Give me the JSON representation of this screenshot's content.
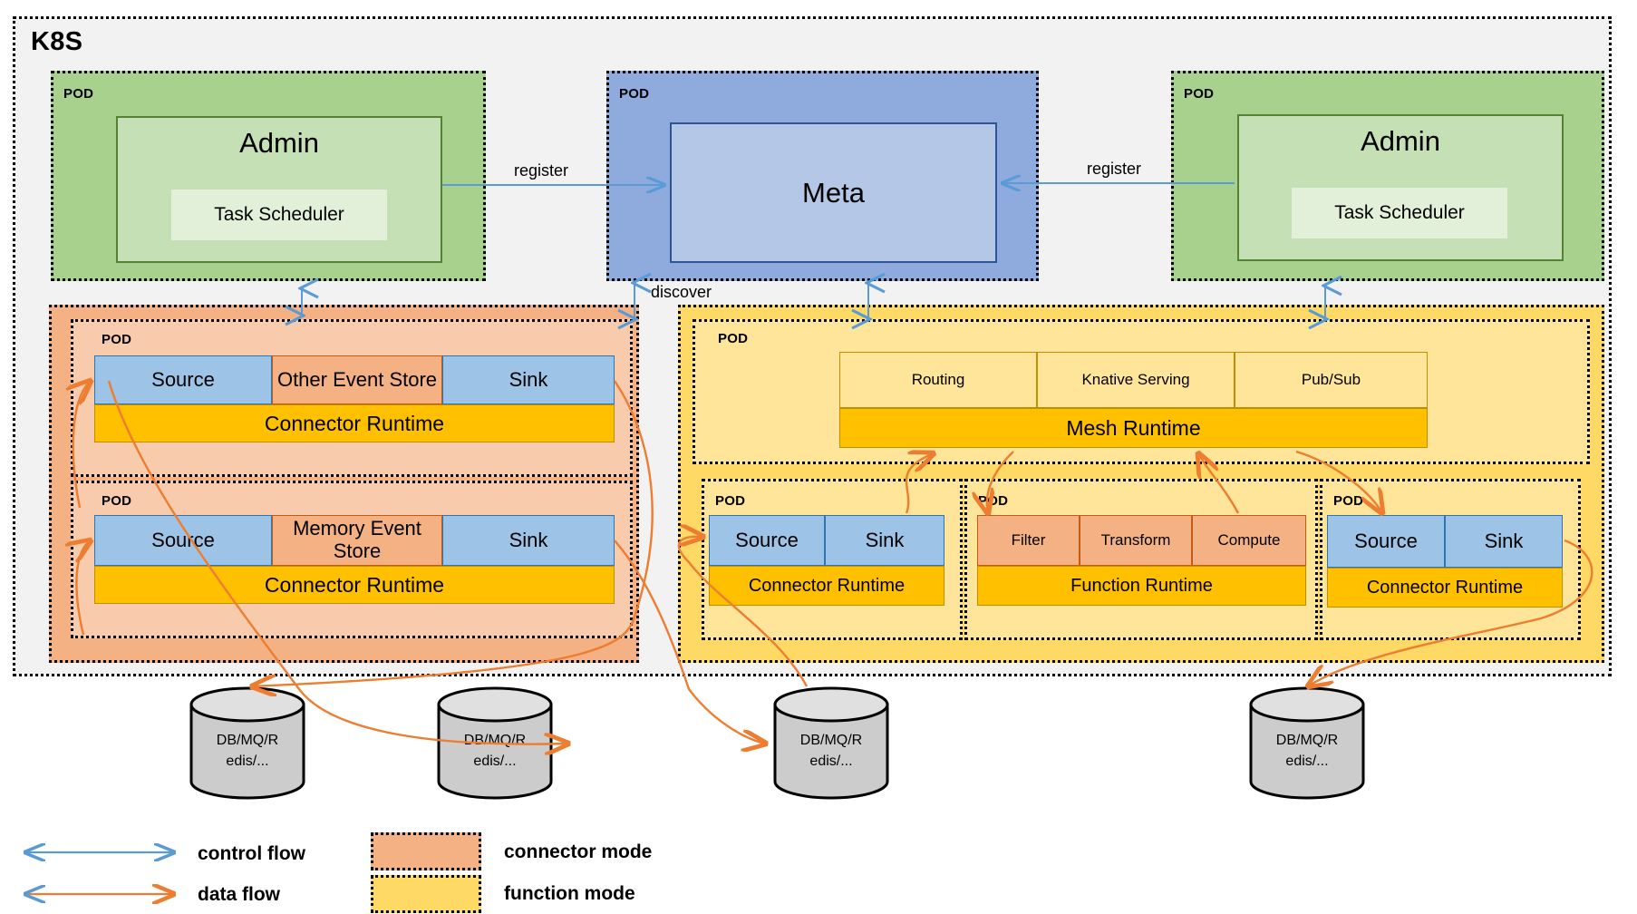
{
  "diagram": {
    "cluster_label": "K8S",
    "pod_label": "POD"
  },
  "admin_left": {
    "pod_label": "POD",
    "title": "Admin",
    "task_scheduler": "Task Scheduler"
  },
  "admin_right": {
    "pod_label": "POD",
    "title": "Admin",
    "task_scheduler": "Task Scheduler"
  },
  "meta": {
    "pod_label": "POD",
    "title": "Meta"
  },
  "edges": {
    "register_left": "register",
    "register_right": "register",
    "discover": "discover"
  },
  "connector_mode": {
    "pods": [
      {
        "pod_label": "POD",
        "cells": [
          "Source",
          "Other Event Store",
          "Sink"
        ],
        "runtime": "Connector Runtime"
      },
      {
        "pod_label": "POD",
        "cells": [
          "Source",
          "Memory Event Store",
          "Sink"
        ],
        "runtime": "Connector Runtime"
      }
    ]
  },
  "function_mode": {
    "mesh_pod": {
      "pod_label": "POD",
      "cells": [
        "Routing",
        "Knative Serving",
        "Pub/Sub"
      ],
      "runtime": "Mesh Runtime"
    },
    "pods": [
      {
        "pod_label": "POD",
        "cells": [
          "Source",
          "Sink"
        ],
        "runtime": "Connector Runtime"
      },
      {
        "pod_label": "POD",
        "cells": [
          "Filter",
          "Transform",
          "Compute"
        ],
        "runtime": "Function Runtime"
      },
      {
        "pod_label": "POD",
        "cells": [
          "Source",
          "Sink"
        ],
        "runtime": "Connector Runtime"
      }
    ]
  },
  "datastores": [
    {
      "line1": "DB/MQ/R",
      "line2": "edis/..."
    },
    {
      "line1": "DB/MQ/R",
      "line2": "edis/..."
    },
    {
      "line1": "DB/MQ/R",
      "line2": "edis/..."
    },
    {
      "line1": "DB/MQ/R",
      "line2": "edis/..."
    }
  ],
  "legend": {
    "control_flow": "control flow",
    "data_flow": "data flow",
    "connector_mode": "connector mode",
    "function_mode": "function mode"
  },
  "colors": {
    "control_flow": "#5b9bd5",
    "data_flow": "#ed7d31",
    "pod_green": "#a9d18e",
    "pod_blue": "#8faadc",
    "connector_mode": "#f4b183",
    "function_mode": "#ffd966",
    "runtime": "#ffc000",
    "cell_blue": "#9dc3e6"
  }
}
